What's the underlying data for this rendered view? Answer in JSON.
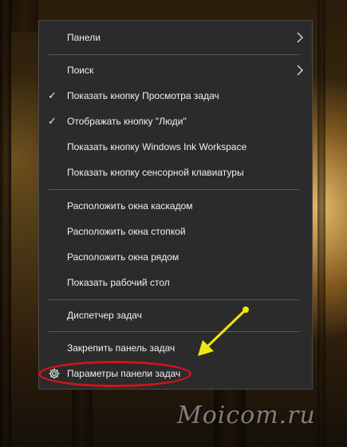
{
  "menu": {
    "items": [
      {
        "label": "Панели",
        "checked": false,
        "submenu": true
      },
      {
        "label": "Поиск",
        "checked": false,
        "submenu": true
      },
      {
        "label": "Показать кнопку Просмотра задач",
        "checked": true,
        "submenu": false
      },
      {
        "label": "Отображать кнопку \"Люди\"",
        "checked": true,
        "submenu": false
      },
      {
        "label": "Показать кнопку Windows Ink Workspace",
        "checked": false,
        "submenu": false
      },
      {
        "label": "Показать кнопку сенсорной клавиатуры",
        "checked": false,
        "submenu": false
      },
      {
        "label": "Расположить окна каскадом",
        "checked": false,
        "submenu": false
      },
      {
        "label": "Расположить окна стопкой",
        "checked": false,
        "submenu": false
      },
      {
        "label": "Расположить окна рядом",
        "checked": false,
        "submenu": false
      },
      {
        "label": "Показать рабочий стол",
        "checked": false,
        "submenu": false
      },
      {
        "label": "Диспетчер задач",
        "checked": false,
        "submenu": false
      },
      {
        "label": "Закрепить панель задач",
        "checked": false,
        "submenu": false
      },
      {
        "label": "Параметры панели задач",
        "checked": false,
        "submenu": false,
        "icon": "gear-icon"
      }
    ],
    "check_glyph": "✓"
  },
  "annotation": {
    "highlight_color": "#d0141c",
    "arrow_color": "#f0e614"
  },
  "watermark": {
    "text": "Moicom.ru"
  },
  "colors": {
    "menu_bg": "#2b2b2b",
    "menu_text": "#f0f0f0",
    "separator": "#5a5a5a"
  }
}
